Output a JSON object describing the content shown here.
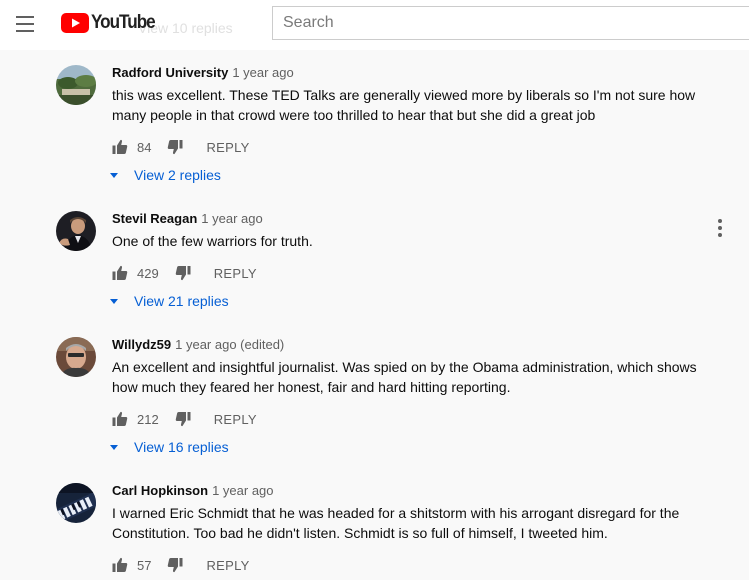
{
  "masthead": {
    "logo_text": "YouTube",
    "search_placeholder": "Search",
    "faded_text": "View 10 replies"
  },
  "ui": {
    "reply_label": "REPLY"
  },
  "comments": [
    {
      "author": "Radford University",
      "time": "1 year ago",
      "text": "this was excellent. These TED Talks are generally viewed more by liberals so I'm not sure how many people in that crowd were too thrilled to hear that but she did a great job",
      "likes": "84",
      "view_replies": "View 2 replies"
    },
    {
      "author": "Stevil Reagan",
      "time": "1 year ago",
      "text": "One of the few warriors for truth.",
      "likes": "429",
      "view_replies": "View 21 replies"
    },
    {
      "author": "Willydz59",
      "time": "1 year ago (edited)",
      "text": "An excellent and insightful journalist. Was spied on by the Obama administration, which shows how much they feared her honest, fair and hard hitting reporting.",
      "likes": "212",
      "view_replies": "View 16 replies"
    },
    {
      "author": "Carl Hopkinson",
      "time": "1 year ago",
      "text": "I warned Eric Schmidt that he was headed for a shitstorm with his arrogant disregard for the Constitution.  Too bad he didn't listen.  Schmidt is so full of himself, I tweeted him.",
      "likes": "57"
    }
  ],
  "colors": {
    "brand_red": "#ff0000",
    "link_blue": "#065fd4",
    "muted_text": "#606060",
    "page_bg": "#f9f9f9"
  }
}
